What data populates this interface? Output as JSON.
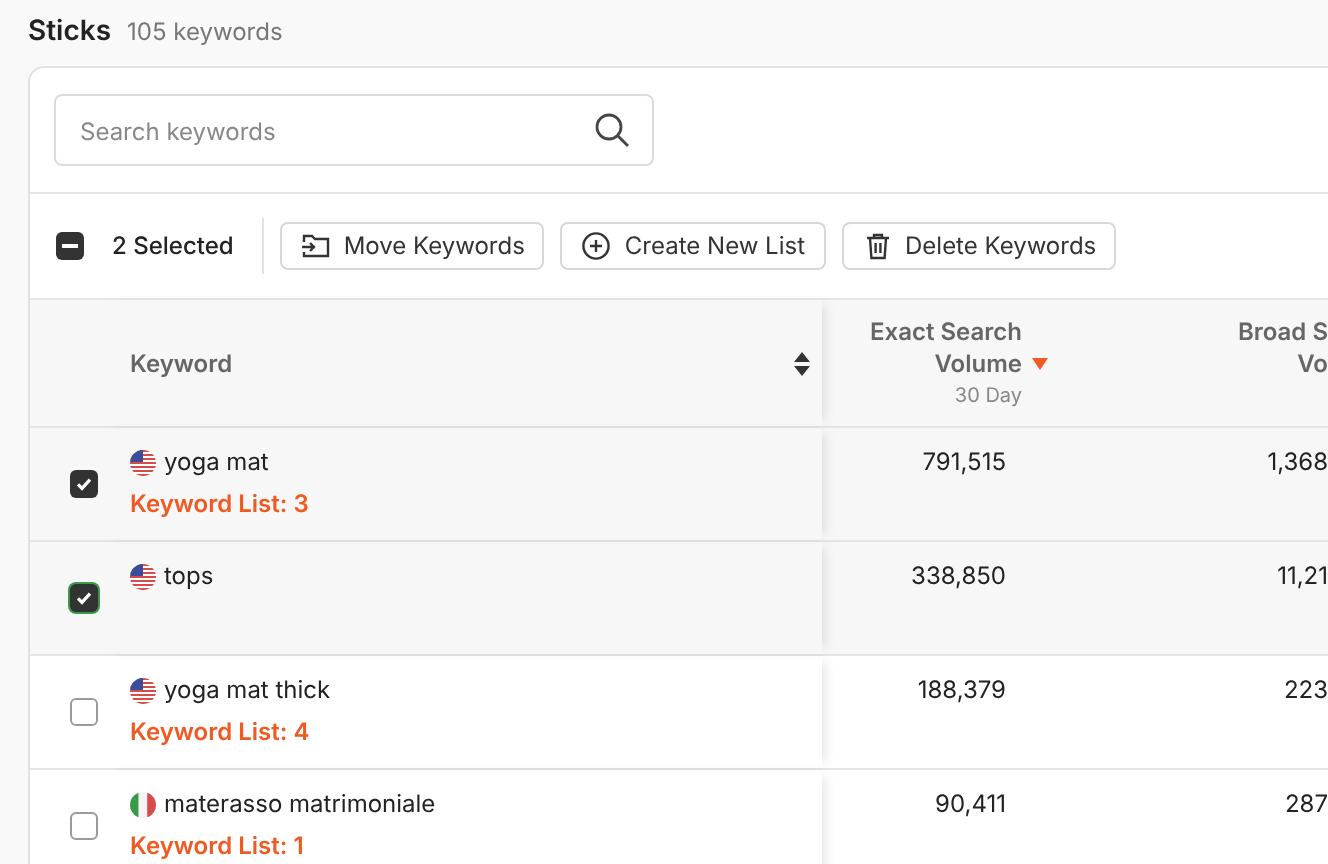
{
  "header": {
    "title": "Sticks",
    "count": "105 keywords"
  },
  "search": {
    "placeholder": "Search keywords"
  },
  "toolbar": {
    "select_all": {
      "indeterminate": true
    },
    "selected_label": "2 Selected",
    "buttons": [
      {
        "kind": "move",
        "label": "Move Keywords"
      },
      {
        "kind": "add",
        "label": "Create New List"
      },
      {
        "kind": "delete",
        "label": "Delete Keywords"
      }
    ]
  },
  "table": {
    "columns": [
      {
        "label": "Keyword",
        "sortable": true
      },
      {
        "label": "Exact Search Volume",
        "sub": "30 Day",
        "sorted_desc": true
      },
      {
        "label": "Broad S",
        "label_line2": "Vo"
      }
    ],
    "rows": [
      {
        "selected": true,
        "focused": false,
        "kind": "us",
        "keyword": "yoga mat",
        "list": "Keyword List: 3",
        "exact": "791,515",
        "broad": "1,368"
      },
      {
        "selected": true,
        "focused": true,
        "kind": "us",
        "keyword": "tops",
        "exact": "338,850",
        "broad": "11,21"
      },
      {
        "selected": false,
        "focused": false,
        "kind": "us",
        "keyword": "yoga mat thick",
        "list": "Keyword List: 4",
        "exact": "188,379",
        "broad": "223"
      },
      {
        "selected": false,
        "focused": false,
        "kind": "it",
        "keyword": "materasso matrimoniale",
        "list": "Keyword List: 1",
        "exact": "90,411",
        "broad": "287"
      }
    ]
  }
}
